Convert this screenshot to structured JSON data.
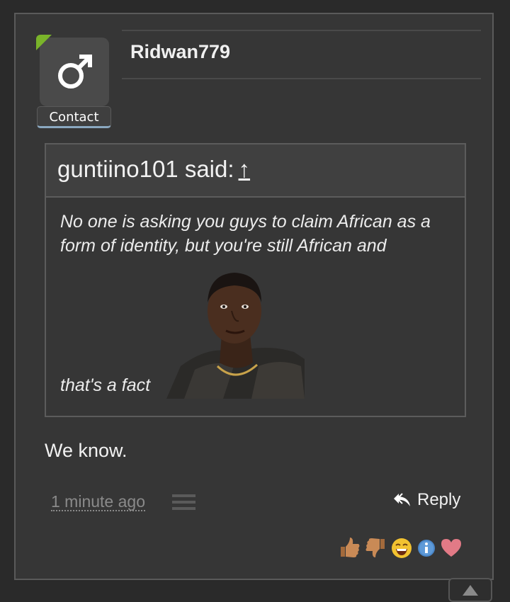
{
  "post": {
    "username": "Ridwan779",
    "contact_label": "Contact",
    "avatar_icon": "male-symbol-icon",
    "online_color": "#7ab42a"
  },
  "quote": {
    "author_said": "guntiino101 said:",
    "jump_icon": "↑",
    "body": "No one is asking you guys to claim African as a form of identity, but you're still African and",
    "tail": "that's a fact"
  },
  "message": "We know.",
  "footer": {
    "time": "1 minute ago",
    "reply_label": "Reply"
  },
  "reactions": [
    "like-icon",
    "dislike-icon",
    "laugh-icon",
    "info-icon",
    "love-icon"
  ]
}
